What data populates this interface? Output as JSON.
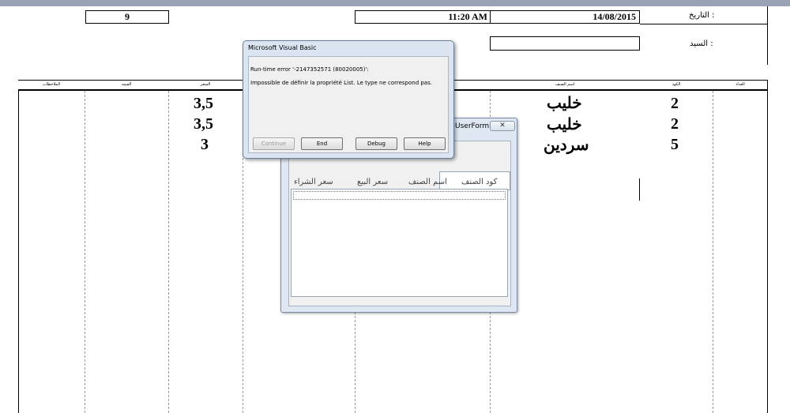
{
  "sheet": {
    "invoice_number": "9",
    "time": "11:20 AM",
    "date": "14/08/2015",
    "date_label": "التاريخ :",
    "customer_label": "السيد :",
    "columns": [
      "الملاحظات",
      "القيمه",
      "السعر",
      "",
      "",
      "اسم الصنف",
      "الكود",
      "العداد"
    ],
    "rows": [
      {
        "price": "3,5",
        "name": "خليب",
        "code": "2"
      },
      {
        "price": "3,5",
        "name": "خليب",
        "code": "2"
      },
      {
        "price": "3",
        "name": "سردين",
        "code": "5"
      }
    ]
  },
  "userform": {
    "title": "UserForm1",
    "close_glyph": "✕",
    "columns": [
      "كود الصنف",
      "اسم الصنف",
      "سعر البيع",
      "سعر الشراء"
    ]
  },
  "error_dialog": {
    "title": "Microsoft Visual Basic",
    "error_line": "Run-time error '-2147352571 (80020005)':",
    "message": "Impossible de définir la propriété List. Le type ne correspond pas.",
    "buttons": {
      "continue": "Continue",
      "end": "End",
      "debug": "Debug",
      "help": "Help"
    }
  }
}
